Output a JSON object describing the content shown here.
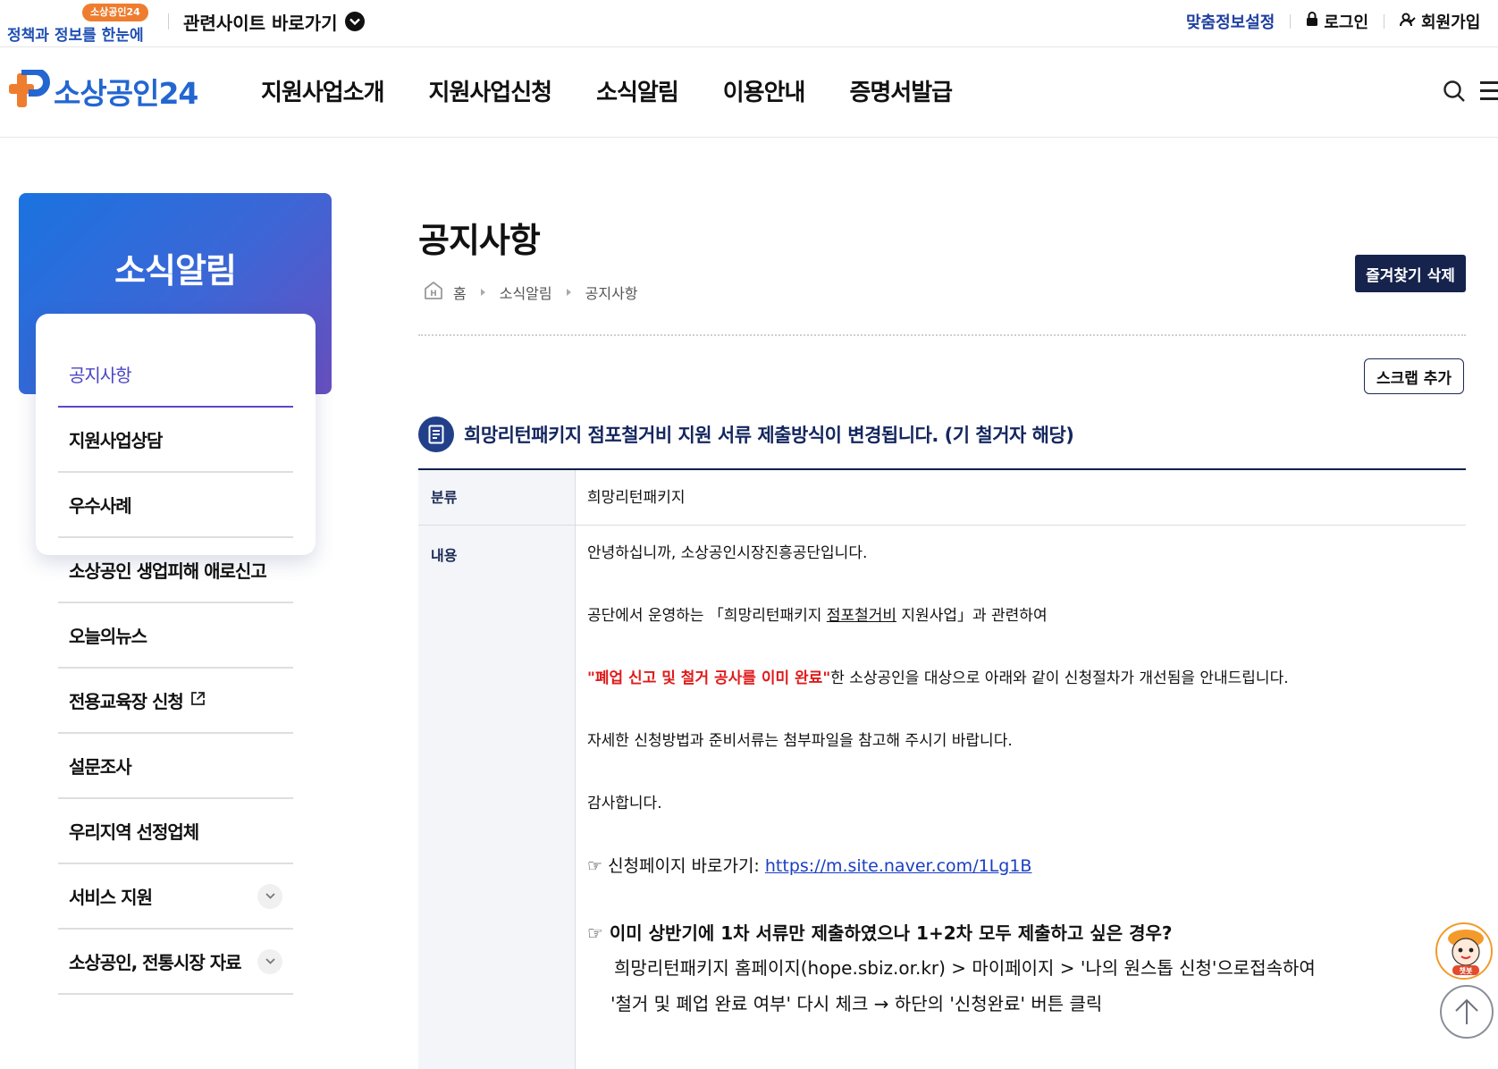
{
  "util_bar": {
    "promo_badge": "소상공인24",
    "promo_text": "정책과 정보를 한눈에",
    "related_sites": "관련사이트 바로가기",
    "custom_info": "맞춤정보설정",
    "login": "로그인",
    "signup": "회원가입"
  },
  "header": {
    "logo_text": "소상공인24",
    "nav": [
      "지원사업소개",
      "지원사업신청",
      "소식알림",
      "이용안내",
      "증명서발급"
    ]
  },
  "sidebar": {
    "title": "소식알림",
    "items": [
      {
        "label": "공지사항",
        "active": true
      },
      {
        "label": "지원사업상담"
      },
      {
        "label": "우수사례"
      },
      {
        "label": "소상공인 생업피해 애로신고"
      },
      {
        "label": "오늘의뉴스"
      },
      {
        "label": "전용교육장 신청",
        "external": true
      },
      {
        "label": "설문조사"
      },
      {
        "label": "우리지역 선정업체"
      },
      {
        "label": "서비스 지원",
        "expandable": true
      },
      {
        "label": "소상공인, 전통시장 자료",
        "expandable": true
      }
    ]
  },
  "content": {
    "page_title": "공지사항",
    "favorite_delete": "즐겨찾기 삭제",
    "breadcrumb": [
      "홈",
      "소식알림",
      "공지사항"
    ],
    "scrap_add": "스크랩 추가",
    "post_title": "희망리턴패키지 점포철거비 지원 서류 제출방식이 변경됩니다. (기 철거자 해당)",
    "category_label": "분류",
    "category_value": "희망리턴패키지",
    "body_label": "내용",
    "body": {
      "p1": "안녕하십니까, 소상공인시장진흥공단입니다.",
      "p2_pre": "공단에서 운영하는 「희망리턴패키지 ",
      "p2_ul": "점포철거비",
      "p2_post": " 지원사업」과 관련하여",
      "p3_red": "\"폐업 신고 및 철거 공사를 이미 완료\"",
      "p3_rest": "한 소상공인을 대상으로 아래와 같이 신청절차가 개선됨을 안내드립니다.",
      "p4": "자세한 신청방법과 준비서류는 첨부파일을 참고해 주시기 바랍니다.",
      "p5": "감사합니다.",
      "link_prefix": "☞ 신청페이지 바로가기: ",
      "link_url": "https://m.site.naver.com/1Lg1B",
      "q_title": "☞ 이미 상반기에 1차 서류만 제출하였으나 1+2차 모두 제출하고 싶은 경우?",
      "q_step1": "희망리턴패키지 홈페이지(hope.sbiz.or.kr) > 마이페이지 > '나의 원스톱 신청'으로접속하여",
      "q_step2": "'철거 및 폐업 완료 여부' 다시 체크 → 하단의 '신청완료' 버튼 클릭"
    }
  },
  "floating": {
    "chatbot_label": "챗봇"
  },
  "colors": {
    "brand_blue": "#2366d1",
    "brand_orange": "#ee7d2f",
    "navy": "#16234d",
    "accent_red": "#e01b1b",
    "active_purple": "#4b45c6"
  }
}
